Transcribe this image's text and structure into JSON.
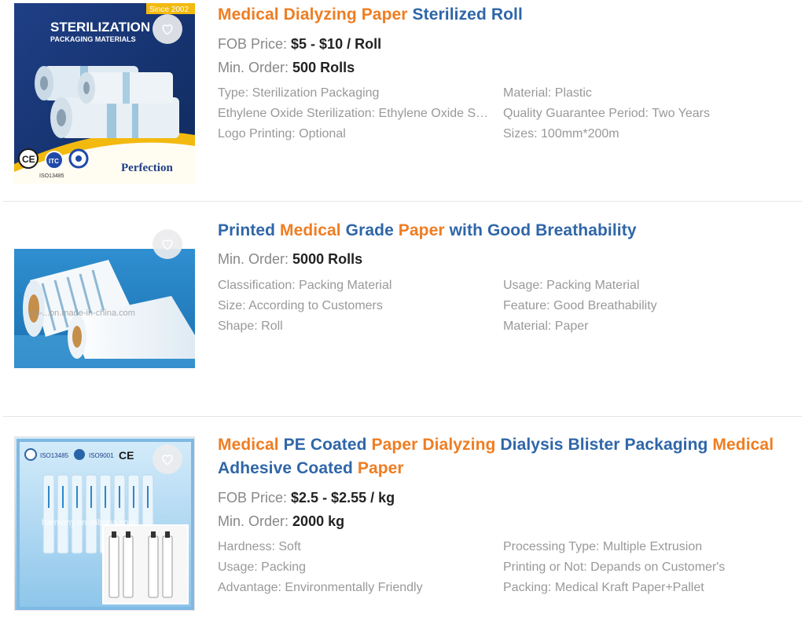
{
  "products": [
    {
      "title": [
        {
          "t": "Medical",
          "k": true
        },
        {
          "t": "Dialyzing",
          "k": true
        },
        {
          "t": "Paper",
          "k": true
        },
        {
          "t": "Sterilized",
          "k": false
        },
        {
          "t": "Roll",
          "k": false
        }
      ],
      "fob_label": "FOB Price:",
      "fob_value": "$5 - $10 / Roll",
      "min_label": "Min. Order:",
      "min_value": "500 Rolls",
      "attrs_left": [
        "Type: Sterilization Packaging",
        "Ethylene Oxide Sterilization: Ethylene Oxide Sterilization",
        "Logo Printing: Optional"
      ],
      "attrs_right": [
        "Material: Plastic",
        "Quality Guarantee Period: Two Years",
        "Sizes: 100mm*200m"
      ],
      "image": {
        "banner": "STERILIZATION",
        "sub": "PACKAGING MATERIALS",
        "since": "Since 2002",
        "brand": "Perfection",
        "iso": "ISO13485"
      }
    },
    {
      "title": [
        {
          "t": "Printed",
          "k": false
        },
        {
          "t": "Medical",
          "k": true
        },
        {
          "t": "Grade",
          "k": false
        },
        {
          "t": "Paper",
          "k": true
        },
        {
          "t": "with",
          "k": false
        },
        {
          "t": "Good",
          "k": false
        },
        {
          "t": "Breathability",
          "k": false
        }
      ],
      "min_label": "Min. Order:",
      "min_value": "5000 Rolls",
      "attrs_left": [
        "Classification: Packing Material",
        "Size: According to Customers",
        "Shape: Roll"
      ],
      "attrs_right": [
        "Usage: Packing Material",
        "Feature: Good Breathability",
        "Material: Paper"
      ],
      "image": {
        "watermark": "op-...on.made-in-china.com"
      }
    },
    {
      "title": [
        {
          "t": "Medical",
          "k": true
        },
        {
          "t": "PE",
          "k": false
        },
        {
          "t": "Coated",
          "k": false
        },
        {
          "t": "Paper",
          "k": true
        },
        {
          "t": "Dialyzing",
          "k": true
        },
        {
          "t": "Dialysis",
          "k": false
        },
        {
          "t": "Blister",
          "k": false
        },
        {
          "t": "Packaging",
          "k": false
        },
        {
          "t": "Medical",
          "k": true
        },
        {
          "t": "Adhesive",
          "k": false
        },
        {
          "t": "Coated",
          "k": false
        },
        {
          "t": "Paper",
          "k": true
        }
      ],
      "fob_label": "FOB Price:",
      "fob_value": "$2.5 - $2.55 / kg",
      "min_label": "Min. Order:",
      "min_value": "2000 kg",
      "attrs_left": [
        "Hardness: Soft",
        "Usage: Packing",
        "Advantage: Environmentally Friendly"
      ],
      "attrs_right": [
        "Processing Type: Multiple Extrusion",
        "Printing or Not: Depands on Customer's",
        "Packing: Medical Kraft Paper+Pallet"
      ],
      "image": {
        "cert1": "ISO13485",
        "cert2": "ISO9001",
        "watermark": "harmony.en.alibaba.com"
      }
    }
  ],
  "colors": {
    "keyword": "#ef7d22",
    "title": "#2f66a8",
    "attr": "#999999",
    "value": "#222222"
  },
  "icons": {
    "favorite": "heart-outline-icon"
  }
}
